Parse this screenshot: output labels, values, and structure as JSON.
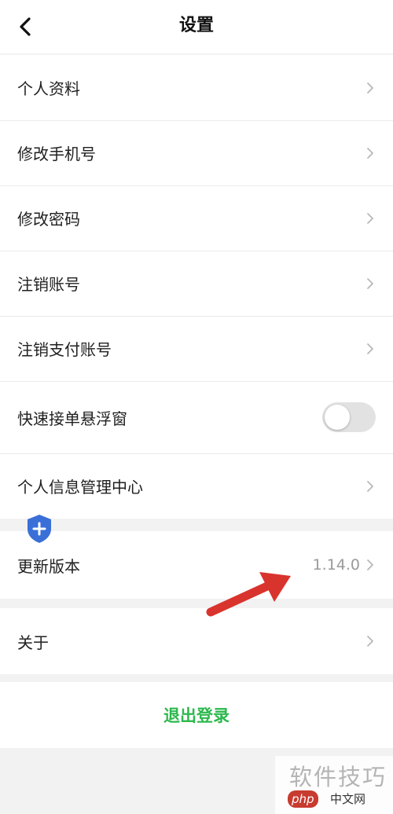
{
  "header": {
    "title": "设置",
    "back_icon": "chevron-left-icon"
  },
  "settings": {
    "profile": "个人资料",
    "change_phone": "修改手机号",
    "change_password": "修改密码",
    "cancel_account": "注销账号",
    "cancel_payment_account": "注销支付账号",
    "quick_order_float": "快速接单悬浮窗",
    "quick_order_float_enabled": false,
    "personal_info_center": "个人信息管理中心"
  },
  "update": {
    "label": "更新版本",
    "version": "1.14.0"
  },
  "about": {
    "label": "关于"
  },
  "logout": {
    "label": "退出登录",
    "color": "#2db84d"
  },
  "watermark": {
    "text": "软件技巧",
    "logo": "php",
    "site": "中文网"
  },
  "annotation": {
    "arrow_color": "#d9332e",
    "shield_color": "#3a6fd8"
  }
}
